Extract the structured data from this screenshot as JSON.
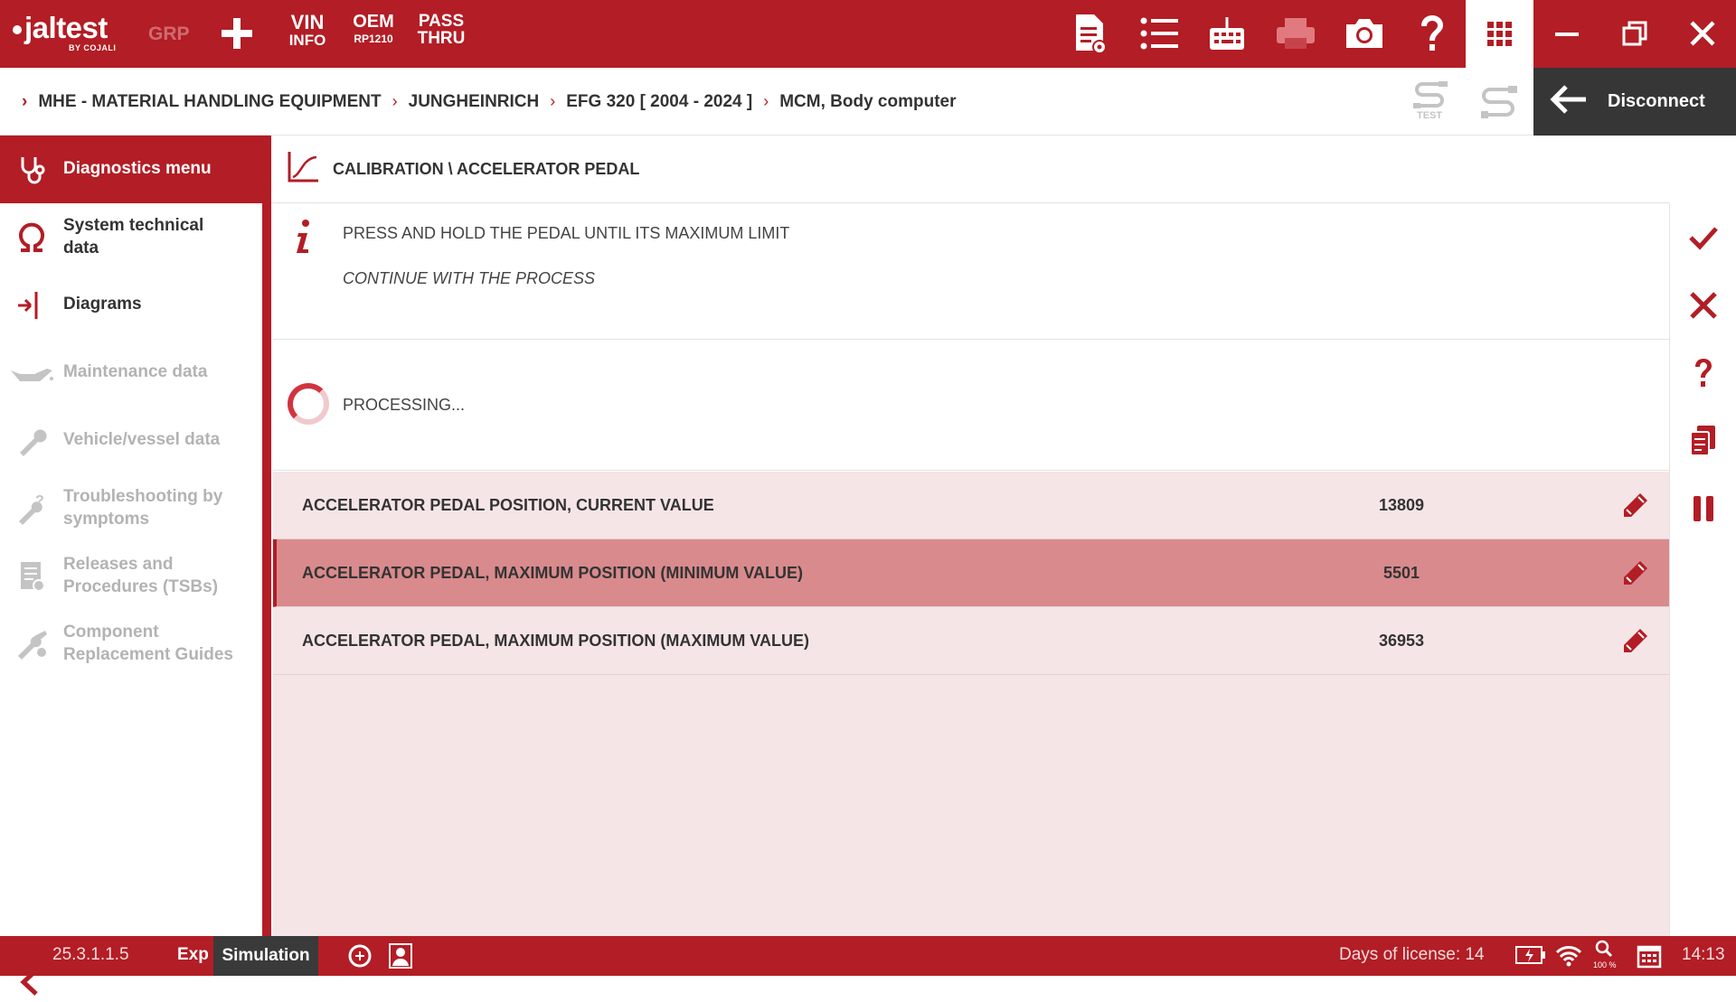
{
  "topbar": {
    "logo_text": "jaltest",
    "logo_sub": "BY COJALI",
    "grp_label": "GRP",
    "vin_line1": "VIN",
    "vin_line2": "INFO",
    "oem_line1": "OEM",
    "oem_line2": "RP1210",
    "pass_line1": "PASS",
    "pass_line2": "THRU",
    "icons": [
      "plus-icon",
      "report-icon",
      "list-icon",
      "keyboard-icon",
      "printer-icon",
      "camera-icon",
      "help-icon",
      "apps-grid-icon",
      "minimize-icon",
      "restore-icon",
      "close-icon"
    ]
  },
  "breadcrumb": {
    "items": [
      "MHE - MATERIAL HANDLING EQUIPMENT",
      "JUNGHEINRICH",
      "EFG 320 [ 2004 - 2024 ]",
      "MCM, Body computer"
    ],
    "test_label": "TEST",
    "disconnect_label": "Disconnect"
  },
  "sidebar": {
    "items": [
      {
        "label": "Diagnostics menu",
        "state": "active"
      },
      {
        "label": "System technical data",
        "state": "enabled"
      },
      {
        "label": "Diagrams",
        "state": "enabled"
      },
      {
        "label": "Maintenance data",
        "state": "disabled"
      },
      {
        "label": "Vehicle/vessel data",
        "state": "disabled"
      },
      {
        "label": "Troubleshooting by symptoms",
        "state": "disabled"
      },
      {
        "label": "Releases and Procedures (TSBs)",
        "state": "disabled"
      },
      {
        "label": "Component Replacement Guides",
        "state": "disabled"
      }
    ]
  },
  "main": {
    "title": "CALIBRATION \\ ACCELERATOR PEDAL",
    "instruction": "PRESS AND HOLD THE PEDAL UNTIL ITS MAXIMUM LIMIT",
    "instruction_sub": "CONTINUE WITH THE PROCESS",
    "status": "PROCESSING...",
    "rows": [
      {
        "name": "ACCELERATOR PEDAL POSITION, CURRENT VALUE",
        "value": "13809"
      },
      {
        "name": "ACCELERATOR PEDAL, MAXIMUM POSITION (MINIMUM VALUE)",
        "value": "5501"
      },
      {
        "name": "ACCELERATOR PEDAL, MAXIMUM POSITION (MAXIMUM VALUE)",
        "value": "36953"
      }
    ],
    "selected_row": 1
  },
  "actions": [
    "accept-icon",
    "cancel-icon",
    "help-icon",
    "clipboard-icon",
    "pause-icon"
  ],
  "statusbar": {
    "version": "25.3.1.1.5",
    "exp_label": "Exp",
    "mode": "Simulation",
    "license": "Days of license: 14",
    "zoom": "100 %",
    "time": "14:13"
  },
  "colors": {
    "brand_red": "#b31d25",
    "selected_row": "#d98a8d",
    "table_bg": "#f6e5e6",
    "dark": "#363636"
  }
}
